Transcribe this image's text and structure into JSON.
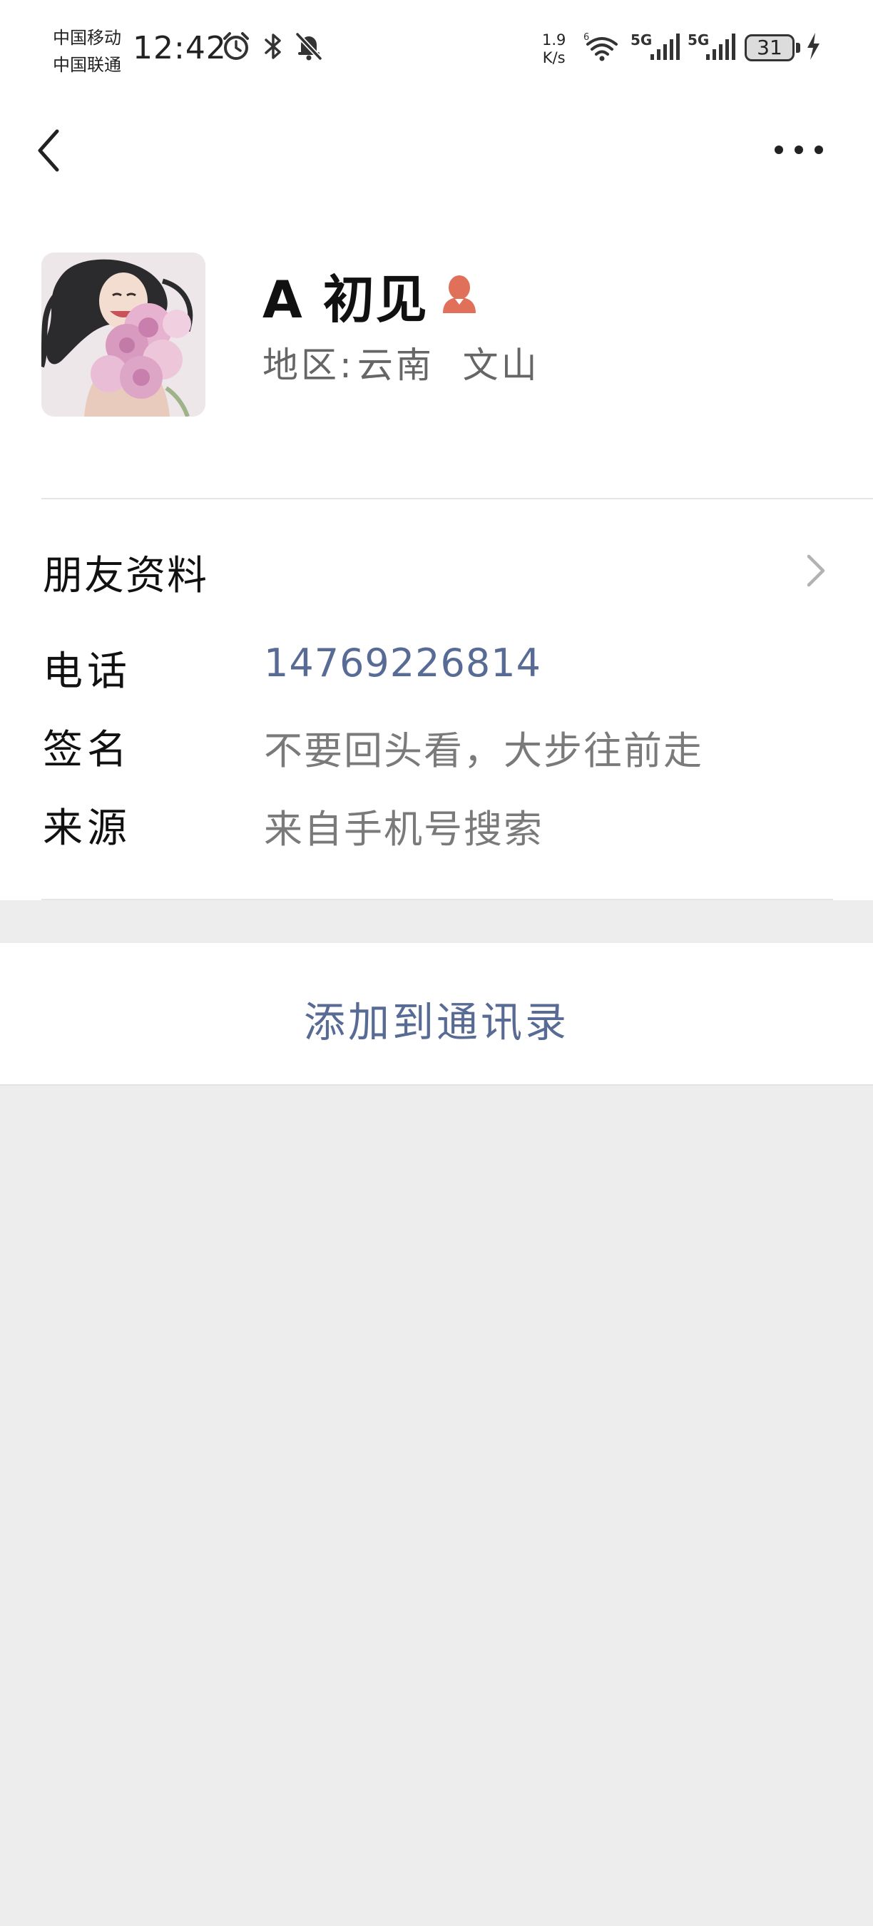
{
  "status_bar": {
    "carrier_1": "中国移动",
    "carrier_2": "中国联通",
    "time": "12:42",
    "net_speed_value": "1.9",
    "net_speed_unit": "K/s",
    "signal_1_label": "5G",
    "signal_2_label": "5G",
    "battery": "31",
    "icons": [
      "alarm-icon",
      "bluetooth-icon",
      "bell-off-icon",
      "wifi-icon",
      "signal-icon",
      "signal-icon",
      "battery-icon",
      "charging-icon"
    ]
  },
  "nav": {
    "back_icon": "chevron-left-icon",
    "more_icon": "more-icon"
  },
  "profile": {
    "name": "A 初见",
    "gender_icon": "female-icon",
    "region_label": "地区:",
    "region_value": "云南  文山"
  },
  "info": {
    "friend_profile_label": "朋友资料",
    "rows": [
      {
        "label": "电话",
        "value": "14769226814"
      },
      {
        "label": "签名",
        "value": "不要回头看，大步往前走"
      },
      {
        "label": "来源",
        "value": "来自手机号搜索"
      }
    ]
  },
  "action": {
    "add_to_contacts": "添加到通讯录"
  },
  "colors": {
    "link": "#576b95",
    "background": "#ededed",
    "gender_female": "#e0705a"
  }
}
